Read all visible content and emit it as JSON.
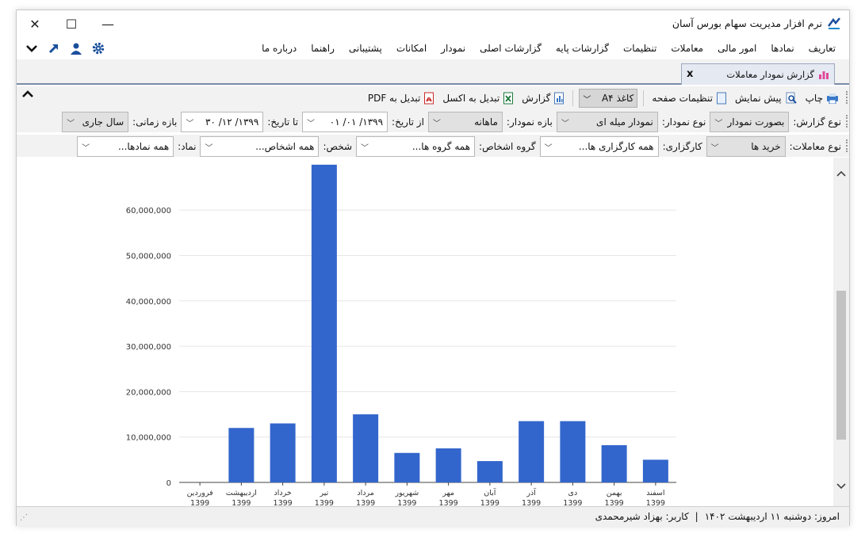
{
  "window": {
    "title": "نرم افزار مدیریت سهام بورس آسان",
    "controls": {
      "minimize": "—",
      "maximize": "☐",
      "close": "✕"
    }
  },
  "menu": [
    "تعاریف",
    "نمادها",
    "امور مالی",
    "معاملات",
    "تنظیمات",
    "گزارشات پایه",
    "گزارشات اصلی",
    "نمودار",
    "امکانات",
    "پشتیبانی",
    "راهنما",
    "درباره ما"
  ],
  "quick_icons": [
    "settings-gear-icon",
    "user-icon",
    "arrow-up-right-icon",
    "chevron-down-icon"
  ],
  "tab": {
    "label": "گزارش نمودار معاملات",
    "close": "x"
  },
  "toolbar": {
    "print": "چاپ",
    "preview": "پیش نمایش",
    "page_settings": "تنظیمات صفحه",
    "paper": "کاغذ A۴",
    "report": "گزارش",
    "excel": "تبدیل به اکسل",
    "pdf": "تبدیل به PDF"
  },
  "filters": {
    "report_type_label": "نوع گزارش:",
    "report_type": "بصورت نمودار",
    "chart_type_label": "نوع نمودار:",
    "chart_type": "نمودار میله ای",
    "chart_period_label": "بازه نمودار:",
    "chart_period": "ماهانه",
    "from_date_label": "از تاریخ:",
    "from_date": "۱۳۹۹/ ۰۱/ ۰۱",
    "to_date_label": "تا تاریخ:",
    "to_date": "۱۳۹۹/ ۱۲/ ۳۰",
    "time_range_label": "بازه زمانی:",
    "time_range": "سال جاری",
    "trade_type_label": "نوع معاملات:",
    "trade_type": "خرید ها",
    "broker_label": "کارگزاری:",
    "broker": "همه کارگزاری ها...",
    "person_group_label": "گروه اشخاص:",
    "person_group": "همه گروه ها...",
    "person_label": "شخص:",
    "person": "همه اشخاص...",
    "symbol_label": "نماد:",
    "symbol": "همه نمادها..."
  },
  "status": {
    "today": "امروز: دوشنبه ۱۱ اردیبهشت ۱۴۰۲",
    "sep": "|",
    "user": "کاربر: بهزاد شیرمحمدی"
  },
  "colors": {
    "bar": "#3366cc",
    "grid": "#e6e6e6",
    "axis": "#444444"
  },
  "chart_data": {
    "type": "bar",
    "categories": [
      "فروردین 1399",
      "اردیبهشت 1399",
      "خرداد 1399",
      "تیر 1399",
      "مرداد 1399",
      "شهریور 1399",
      "مهر 1399",
      "آبان 1399",
      "آذر 1399",
      "دی 1399",
      "بهمن 1399",
      "اسفند 1399"
    ],
    "values": [
      0,
      12000000,
      13000000,
      70000000,
      15000000,
      6500000,
      7500000,
      4700000,
      13500000,
      13500000,
      8200000,
      5000000
    ],
    "yticks": [
      "0",
      "10,000,000",
      "20,000,000",
      "30,000,000",
      "40,000,000",
      "50,000,000",
      "60,000,000"
    ],
    "ylim": [
      0,
      60000000
    ],
    "grid": true,
    "title": "",
    "xlabel": "",
    "ylabel": ""
  }
}
